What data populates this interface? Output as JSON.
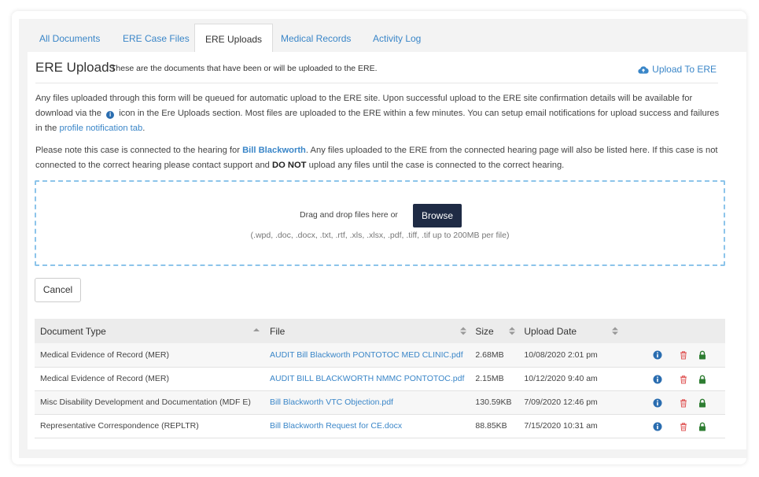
{
  "tabs": [
    {
      "label": "All Documents"
    },
    {
      "label": "ERE Case Files"
    },
    {
      "label": "ERE Uploads",
      "active": true
    },
    {
      "label": "Medical Records"
    },
    {
      "label": "Activity Log"
    }
  ],
  "header": {
    "title": "ERE Uploads",
    "subtitle": "These are the documents that have been or will be uploaded to the ERE.",
    "upload_label": "Upload To ERE",
    "upload_icon": "cloud-upload-icon"
  },
  "info": {
    "p1_a": "Any files uploaded through this form will be queued for automatic upload to the ERE site. Upon successful upload to the ERE site confirmation details will be available for download via the",
    "p1_b": "icon in the Ere Uploads section. Most files are uploaded to the ERE within a few minutes. You can setup email notifications for upload success and failures in the",
    "p1_link": "profile notification tab",
    "p1_end": ".",
    "p2_a": "Please note this case is connected to the hearing for",
    "p2_name": "Bill Blackworth",
    "p2_b": ". Any files uploaded to the ERE from the connected hearing page will also be listed here. If this case is not connected to the correct hearing please contact support and",
    "p2_bold": "DO NOT",
    "p2_c": "upload any files until the case is connected to the correct hearing."
  },
  "dropzone": {
    "prompt": "Drag and drop files here or",
    "browse_label": "Browse",
    "types": "(.wpd, .doc, .docx, .txt, .rtf, .xls, .xlsx, .pdf, .tiff, .tif up to 200MB per file)"
  },
  "cancel_label": "Cancel",
  "table": {
    "columns": [
      "Document Type",
      "File",
      "Size",
      "Upload Date"
    ],
    "rows": [
      {
        "type": "Medical Evidence of Record (MER)",
        "file": "AUDIT Bill Blackworth PONTOTOC MED CLINIC.pdf",
        "size": "2.68MB",
        "date": "10/08/2020 2:01 pm"
      },
      {
        "type": "Medical Evidence of Record (MER)",
        "file": "AUDIT BILL BLACKWORTH NMMC PONTOTOC.pdf",
        "size": "2.15MB",
        "date": "10/12/2020 9:40 am"
      },
      {
        "type": "Misc Disability Development and Documentation (MDF E)",
        "file": "Bill Blackworth VTC Objection.pdf",
        "size": "130.59KB",
        "date": "7/09/2020 12:46 pm"
      },
      {
        "type": "Representative Correspondence (REPLTR)",
        "file": "Bill Blackworth Request for CE.docx",
        "size": "88.85KB",
        "date": "7/15/2020 10:31 am"
      }
    ]
  },
  "colors": {
    "link": "#3a86c8",
    "info": "#2a6db0",
    "trash": "#e05a5a",
    "lock": "#2e7d32",
    "browse": "#1f2b45",
    "dashed": "#8cc4ea"
  }
}
